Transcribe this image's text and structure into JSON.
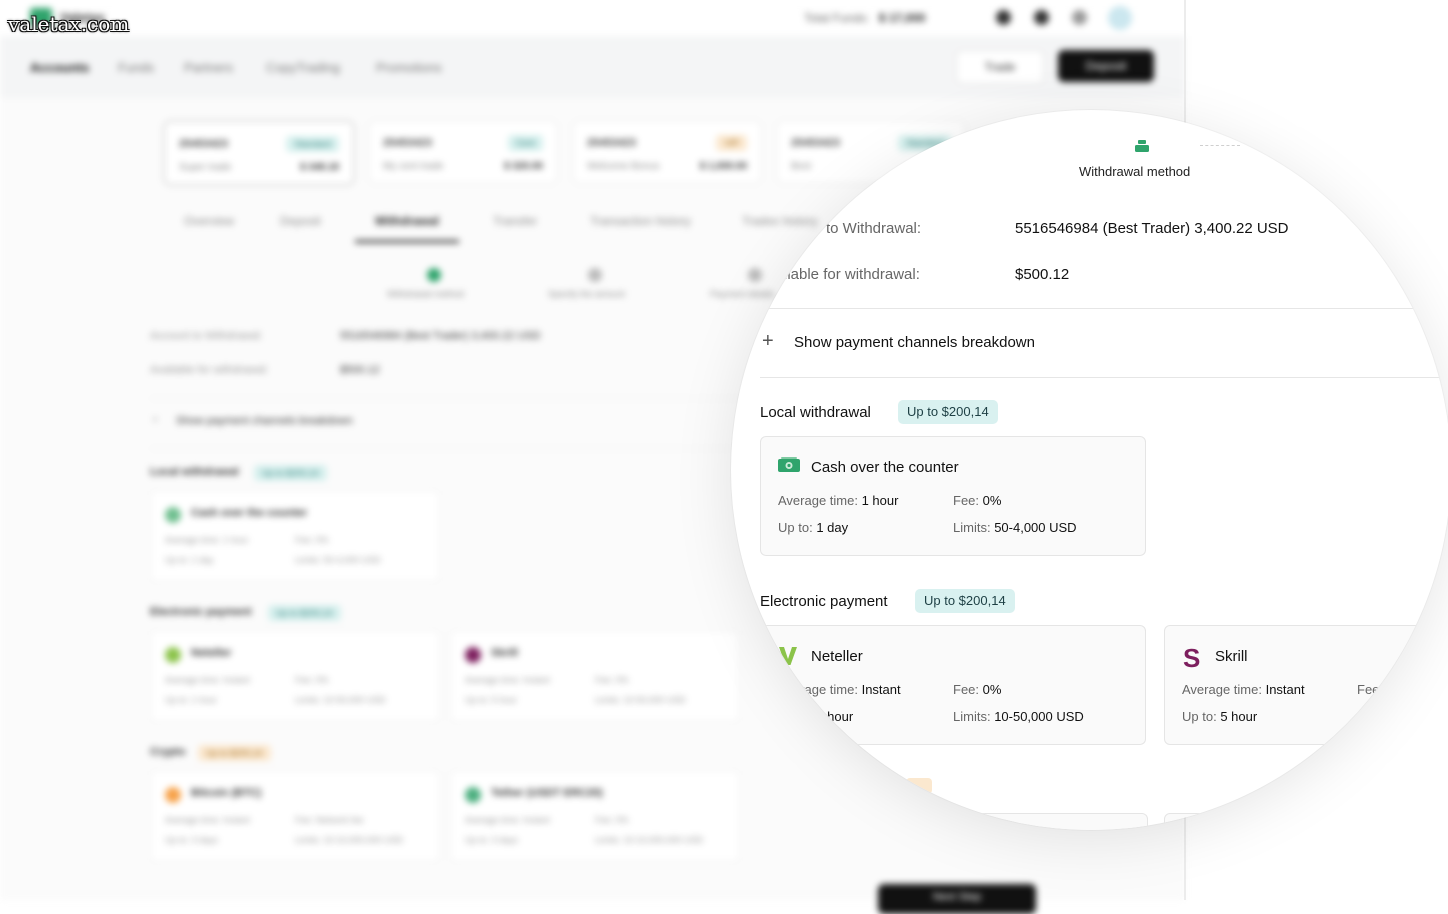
{
  "watermark": "valetax.com",
  "header": {
    "brand": "Valetax",
    "total_funds_label": "Total Funds:",
    "total_funds_value": "$ 17,000",
    "nav": [
      "Accounts",
      "Funds",
      "Partners",
      "CopyTrading",
      "Promotions"
    ],
    "trade_label": "Trade",
    "deposit_label": "Deposit"
  },
  "accounts": [
    {
      "number": "25453423",
      "type": "Standard",
      "name": "Super trade",
      "balance": "$ 348.18"
    },
    {
      "number": "25453423",
      "type": "Cent",
      "name": "My cent trade",
      "balance": "$ 320.00"
    },
    {
      "number": "25453423",
      "type": "VIP",
      "name": "Welcome Bonus",
      "balance": "$ 1,000.00"
    },
    {
      "number": "25453423",
      "type": "Standard",
      "name": "Best",
      "balance": ""
    }
  ],
  "account_tabs": [
    "Overview",
    "Deposit",
    "Withdrawal",
    "Transfer",
    "Transaction history",
    "Trades history"
  ],
  "steps": [
    "Withdrawal method",
    "Specify the amount",
    "Payment details"
  ],
  "withdrawal": {
    "method_step_label": "Withdrawal method",
    "account_label": "Account to Withdrawal:",
    "account_value": "5516546984 (Best Trader) 3,400.22 USD",
    "available_label": "Available for withdrawal:",
    "available_value": "$500.12",
    "breakdown_label": "Show payment channels breakdown",
    "local": {
      "title": "Local withdrawal",
      "badge": "Up to $200,14",
      "cards": [
        {
          "name": "Cash over the counter",
          "avg_label": "Average time:",
          "avg": "1 hour",
          "fee_label": "Fee:",
          "fee": "0%",
          "upto_label": "Up to:",
          "upto": "1 day",
          "limits_label": "Limits:",
          "limits": "50-4,000 USD"
        }
      ]
    },
    "electronic": {
      "title": "Electronic payment",
      "badge": "Up to $200,14",
      "cards": [
        {
          "name": "Neteller",
          "avg_label": "Average time:",
          "avg": "Instant",
          "fee_label": "Fee:",
          "fee": "0%",
          "upto_label": "Up to:",
          "upto": "1 hour",
          "limits_label": "Limits:",
          "limits": "10-50,000 USD"
        },
        {
          "name": "Skrill",
          "avg_label": "Average time:",
          "avg": "Instant",
          "fee_label": "Fee:",
          "fee": "0%",
          "upto_label": "Up to:",
          "upto": "5 hour",
          "limits_label": "Limits:",
          "limits": "10-50,000 USD"
        }
      ]
    },
    "crypto": {
      "title": "Crypto",
      "badge": "Up to $200,14",
      "cards": [
        {
          "name": "Bitcoin (BTC)",
          "avg_label": "Average time:",
          "avg": "Instant",
          "fee_label": "Fee:",
          "fee": "Network fee",
          "upto_label": "Up to:",
          "upto": "3 days",
          "limits_label": "Limits:",
          "limits": "10-10,000,000 USD"
        },
        {
          "name": "Tether (USDT ERC20)",
          "avg_label": "Average time:",
          "avg": "Instant",
          "fee_label": "Fee:",
          "fee": "0%",
          "upto_label": "Up to:",
          "upto": "3 days",
          "limits_label": "Limits:",
          "limits": "10-10,000,000 USD"
        }
      ]
    },
    "next_label": "Next Step"
  },
  "colors": {
    "brand_green": "#2fa46c",
    "badge_teal_bg": "#d9f1f0",
    "badge_orange_bg": "#fbe8cf",
    "skrill_purple": "#7d1f5e",
    "neteller_green": "#8bc34a"
  }
}
